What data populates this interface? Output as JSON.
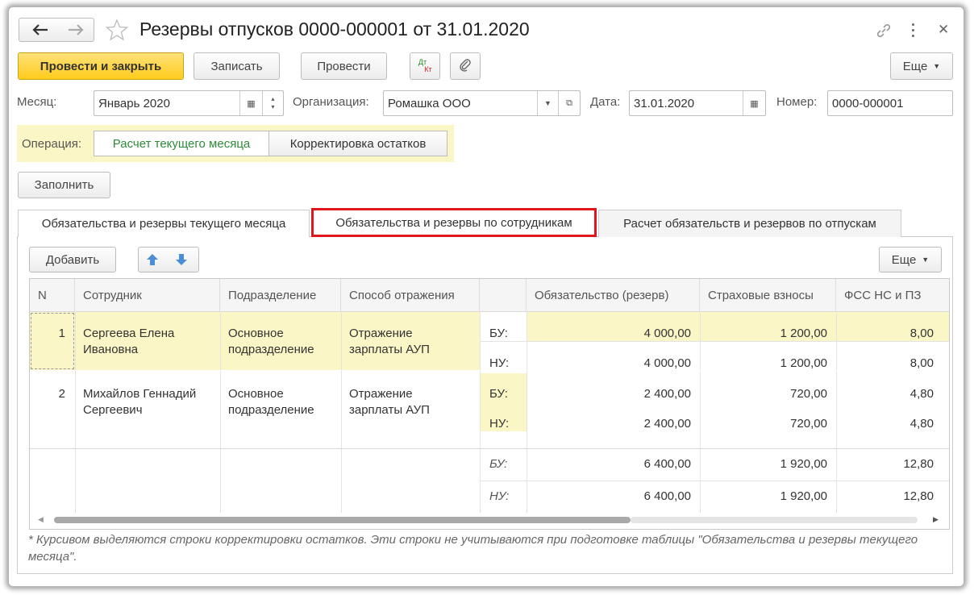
{
  "window": {
    "title": "Резервы отпусков 0000-000001 от 31.01.2020",
    "back_icon": "arrow-left-icon",
    "forward_icon": "arrow-right-icon",
    "star_icon": "star-icon",
    "link_icon": "link-icon",
    "more_icon": "more-vertical-icon",
    "close_icon": "close-icon"
  },
  "toolbar": {
    "post_close": "Провести и закрыть",
    "save": "Записать",
    "post": "Провести",
    "dtkt_top": "Дт",
    "dtkt_bottom": "Кт",
    "attach_icon": "paperclip-icon",
    "more": "Еще"
  },
  "form": {
    "month_label": "Месяц:",
    "month_value": "Январь 2020",
    "org_label": "Организация:",
    "org_value": "Ромашка ООО",
    "date_label": "Дата:",
    "date_value": "31.01.2020",
    "number_label": "Номер:",
    "number_value": "0000-000001",
    "operation_label": "Операция:",
    "op_current": "Расчет текущего месяца",
    "op_correction": "Корректировка остатков",
    "fill_button": "Заполнить"
  },
  "tabs": [
    {
      "label": "Обязательства и резервы текущего месяца"
    },
    {
      "label": "Обязательства и резервы по сотрудникам"
    },
    {
      "label": "Расчет обязательств и резервов по отпускам"
    }
  ],
  "table_toolbar": {
    "add": "Добавить",
    "up_icon": "arrow-up-icon",
    "down_icon": "arrow-down-icon",
    "more": "Еще"
  },
  "table": {
    "columns": [
      "N",
      "Сотрудник",
      "Подразделение",
      "Способ отражения",
      "",
      "Обязательство (резерв)",
      "Страховые взносы",
      "ФСС НС и ПЗ"
    ],
    "rows": [
      {
        "n": "1",
        "employee": "Сергеева Елена Ивановна",
        "department": "Основное подразделение",
        "method": "Отражение зарплаты АУП",
        "bu_label": "БУ:",
        "nu_label": "НУ:",
        "bu": [
          "4 000,00",
          "1 200,00",
          "8,00"
        ],
        "nu": [
          "4 000,00",
          "1 200,00",
          "8,00"
        ]
      },
      {
        "n": "2",
        "employee": "Михайлов Геннадий Сергеевич",
        "department": "Основное подразделение",
        "method": "Отражение зарплаты АУП",
        "bu_label": "БУ:",
        "nu_label": "НУ:",
        "bu": [
          "2 400,00",
          "720,00",
          "4,80"
        ],
        "nu": [
          "2 400,00",
          "720,00",
          "4,80"
        ]
      }
    ],
    "totals": {
      "bu_label": "БУ:",
      "nu_label": "НУ:",
      "bu": [
        "6 400,00",
        "1 920,00",
        "12,80"
      ],
      "nu": [
        "6 400,00",
        "1 920,00",
        "12,80"
      ]
    }
  },
  "footnote": "* Курсивом выделяются строки корректировки остатков. Эти строки не учитываются при подготовке таблицы \"Обязательства и резервы текущего месяца\".",
  "colors": {
    "highlight_yellow": "#fbf6c5",
    "primary_button": "#ffd232",
    "active_op_text": "#2e8b3a",
    "tab_highlight_border": "#e0161f"
  }
}
